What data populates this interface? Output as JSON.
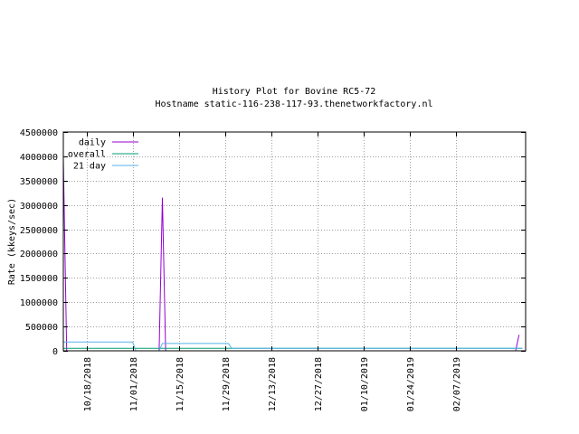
{
  "chart_data": {
    "type": "line",
    "title": "History Plot for Bovine RC5-72",
    "subtitle": "Hostname static-116-238-117-93.thenetworkfactory.nl",
    "xlabel": "",
    "ylabel": "Rate (kkeys/sec)",
    "x_axis": {
      "type": "date",
      "range": [
        "2018-10-11",
        "2019-02-28"
      ],
      "ticks": [
        "10/18/2018",
        "11/01/2018",
        "11/15/2018",
        "11/29/2018",
        "12/13/2018",
        "12/27/2018",
        "01/10/2019",
        "01/24/2019",
        "02/07/2019"
      ],
      "tick_dates": [
        "2018-10-18",
        "2018-11-01",
        "2018-11-15",
        "2018-11-29",
        "2018-12-13",
        "2018-12-27",
        "2019-01-10",
        "2019-01-24",
        "2019-02-07"
      ]
    },
    "y_axis": {
      "range": [
        0,
        4500000
      ],
      "ticks": [
        "0",
        "500000",
        "1000000",
        "1500000",
        "2000000",
        "2500000",
        "3000000",
        "3500000",
        "4000000",
        "4500000"
      ],
      "tick_values": [
        0,
        500000,
        1000000,
        1500000,
        2000000,
        2500000,
        3000000,
        3500000,
        4000000,
        4500000
      ]
    },
    "grid": true,
    "legend_position": "top-left",
    "series": [
      {
        "name": "daily",
        "color": "#9400d3",
        "points": [
          [
            "2018-10-11",
            3950000
          ],
          [
            "2018-10-12",
            0
          ],
          [
            "2018-11-09",
            0
          ],
          [
            "2018-11-10",
            3150000
          ],
          [
            "2018-11-11",
            0
          ],
          [
            "2019-02-25",
            0
          ],
          [
            "2019-02-26",
            330000
          ]
        ]
      },
      {
        "name": "overall",
        "color": "#009e73",
        "points": [
          [
            "2018-10-11",
            50000
          ],
          [
            "2019-02-27",
            50000
          ]
        ]
      },
      {
        "name": "21 day",
        "color": "#56b4e9",
        "points": [
          [
            "2018-10-11",
            180000
          ],
          [
            "2018-11-01",
            180000
          ],
          [
            "2018-11-02",
            0
          ],
          [
            "2018-11-09",
            0
          ],
          [
            "2018-11-10",
            150000
          ],
          [
            "2018-11-30",
            150000
          ],
          [
            "2018-12-01",
            50000
          ],
          [
            "2019-02-27",
            50000
          ]
        ]
      }
    ]
  }
}
